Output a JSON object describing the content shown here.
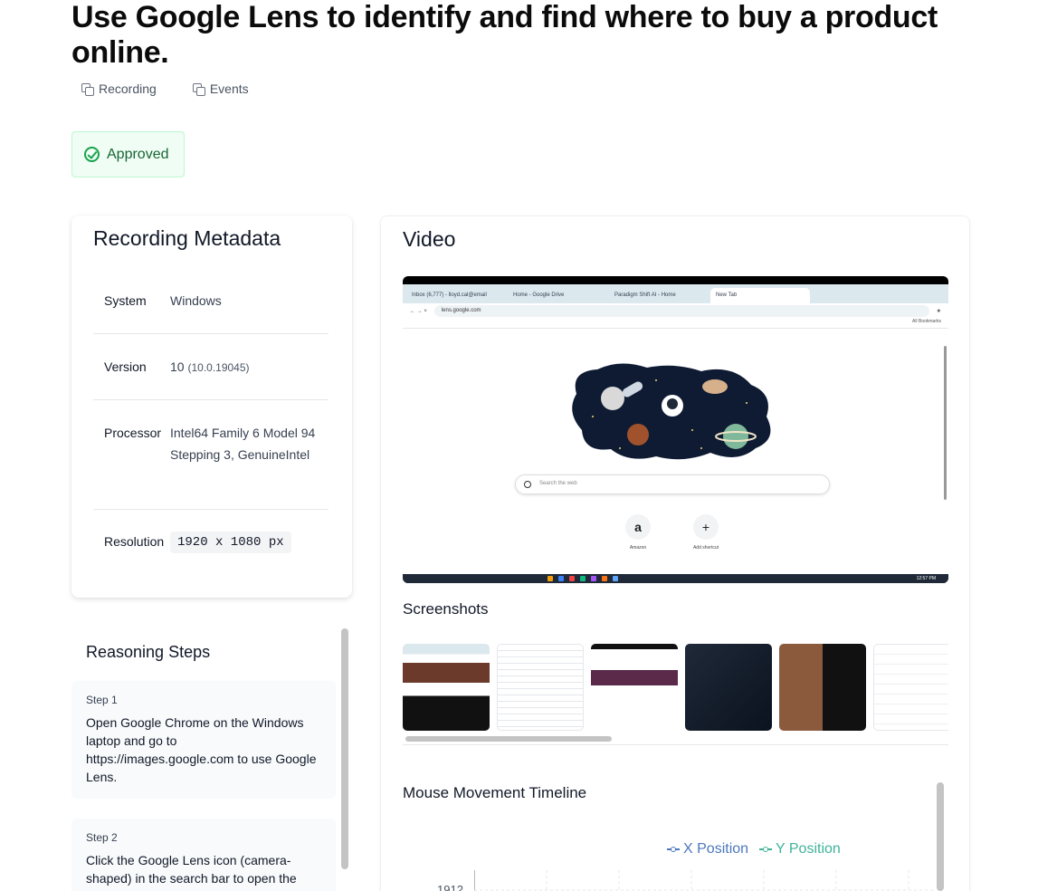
{
  "title": "Use Google Lens to identify and find where to buy a product online.",
  "links": {
    "recording": "Recording",
    "events": "Events"
  },
  "status": {
    "label": "Approved",
    "color": "#16a34a"
  },
  "metadata": {
    "heading": "Recording Metadata",
    "system_label": "System",
    "system_value": "Windows",
    "version_label": "Version",
    "version_value": "10",
    "version_detail": "(10.0.19045)",
    "processor_label": "Processor",
    "processor_value": "Intel64 Family 6 Model 94 Stepping 3, GenuineIntel",
    "resolution_label": "Resolution",
    "resolution_value": "1920 x 1080 px"
  },
  "video": {
    "heading": "Video",
    "browser": {
      "tabs": [
        "Inbox (6,777) - lloyd.cal@email",
        "Home - Google Drive",
        "Paradigm Shift AI - Home",
        "New Tab"
      ],
      "url": "lens.google.com",
      "bookmarks": "All Bookmarks",
      "search_placeholder": "Search the web",
      "shortcuts": [
        {
          "glyph": "a",
          "label": "Amazon"
        },
        {
          "glyph": "+",
          "label": "Add shortcut"
        }
      ],
      "clock": "12:57 PM"
    }
  },
  "screenshots": {
    "heading": "Screenshots"
  },
  "timeline": {
    "heading": "Mouse Movement Timeline",
    "legend_x": "X Position",
    "legend_y": "Y Position",
    "y_tick": "1912",
    "colors": {
      "x": "#4b77be",
      "y": "#3fb39a"
    }
  },
  "reasoning": {
    "heading": "Reasoning Steps",
    "steps": [
      {
        "title": "Step 1",
        "text": "Open Google Chrome on the Windows laptop and go to https://images.google.com to use Google Lens."
      },
      {
        "title": "Step 2",
        "text": "Click the Google Lens icon (camera-shaped) in the search bar to open the"
      }
    ]
  }
}
